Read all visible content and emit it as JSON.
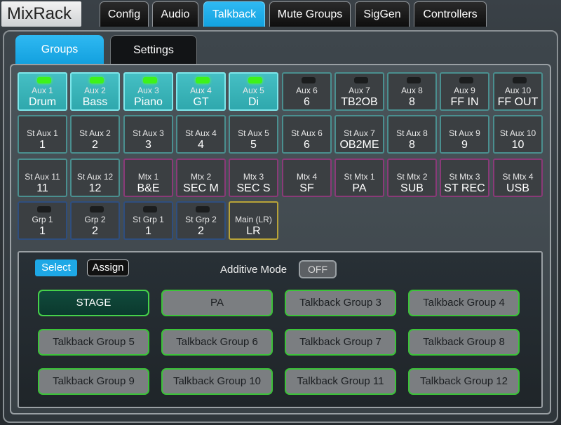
{
  "app": {
    "logo": "MixRack"
  },
  "top_tabs": [
    {
      "label": "Config"
    },
    {
      "label": "Audio"
    },
    {
      "label": "Talkback",
      "active": true
    },
    {
      "label": "Mute Groups"
    },
    {
      "label": "SigGen"
    },
    {
      "label": "Controllers"
    }
  ],
  "sub_tabs": [
    {
      "label": "Groups",
      "active": true
    },
    {
      "label": "Settings"
    }
  ],
  "buses": [
    {
      "label": "Aux 1",
      "value": "Drum",
      "led": "on",
      "selected": true,
      "kind": "aux"
    },
    {
      "label": "Aux 2",
      "value": "Bass",
      "led": "on",
      "selected": true,
      "kind": "aux"
    },
    {
      "label": "Aux 3",
      "value": "Piano",
      "led": "on",
      "selected": true,
      "kind": "aux"
    },
    {
      "label": "Aux 4",
      "value": "GT",
      "led": "on",
      "selected": true,
      "kind": "aux"
    },
    {
      "label": "Aux 5",
      "value": "Di",
      "led": "on",
      "selected": true,
      "kind": "aux"
    },
    {
      "label": "Aux 6",
      "value": "6",
      "led": "off",
      "kind": "aux"
    },
    {
      "label": "Aux 7",
      "value": "TB2OB",
      "led": "off",
      "kind": "aux"
    },
    {
      "label": "Aux 8",
      "value": "8",
      "led": "off",
      "kind": "aux"
    },
    {
      "label": "Aux 9",
      "value": "FF IN",
      "led": "off",
      "kind": "aux"
    },
    {
      "label": "Aux 10",
      "value": "FF OUT",
      "led": "off",
      "kind": "aux"
    },
    {
      "label": "St Aux 1",
      "value": "1",
      "led": "none",
      "kind": "aux"
    },
    {
      "label": "St Aux 2",
      "value": "2",
      "led": "none",
      "kind": "aux"
    },
    {
      "label": "St Aux 3",
      "value": "3",
      "led": "none",
      "kind": "aux"
    },
    {
      "label": "St Aux 4",
      "value": "4",
      "led": "none",
      "kind": "aux"
    },
    {
      "label": "St Aux 5",
      "value": "5",
      "led": "none",
      "kind": "aux"
    },
    {
      "label": "St Aux 6",
      "value": "6",
      "led": "none",
      "kind": "aux"
    },
    {
      "label": "St Aux 7",
      "value": "OB2ME",
      "led": "none",
      "kind": "aux"
    },
    {
      "label": "St Aux 8",
      "value": "8",
      "led": "none",
      "kind": "aux"
    },
    {
      "label": "St Aux 9",
      "value": "9",
      "led": "none",
      "kind": "aux"
    },
    {
      "label": "St Aux 10",
      "value": "10",
      "led": "none",
      "kind": "aux"
    },
    {
      "label": "St Aux 11",
      "value": "11",
      "led": "none",
      "kind": "aux"
    },
    {
      "label": "St Aux 12",
      "value": "12",
      "led": "none",
      "kind": "aux"
    },
    {
      "label": "Mtx 1",
      "value": "B&E",
      "led": "none",
      "kind": "mtx"
    },
    {
      "label": "Mtx 2",
      "value": "SEC M",
      "led": "none",
      "kind": "mtx"
    },
    {
      "label": "Mtx 3",
      "value": "SEC S",
      "led": "none",
      "kind": "mtx"
    },
    {
      "label": "Mtx 4",
      "value": "SF",
      "led": "none",
      "kind": "mtx"
    },
    {
      "label": "St Mtx 1",
      "value": "PA",
      "led": "none",
      "kind": "mtx"
    },
    {
      "label": "St Mtx 2",
      "value": "SUB",
      "led": "none",
      "kind": "mtx"
    },
    {
      "label": "St Mtx 3",
      "value": "ST REC",
      "led": "none",
      "kind": "mtx"
    },
    {
      "label": "St Mtx 4",
      "value": "USB",
      "led": "none",
      "kind": "mtx"
    },
    {
      "label": "Grp 1",
      "value": "1",
      "led": "off",
      "kind": "grp"
    },
    {
      "label": "Grp 2",
      "value": "2",
      "led": "off",
      "kind": "grp"
    },
    {
      "label": "St Grp 1",
      "value": "1",
      "led": "off",
      "kind": "grp"
    },
    {
      "label": "St Grp 2",
      "value": "2",
      "led": "off",
      "kind": "grp"
    },
    {
      "label": "Main (LR)",
      "value": "LR",
      "led": "none",
      "kind": "main"
    }
  ],
  "mode_buttons": {
    "select": "Select",
    "assign": "Assign",
    "active": "Select"
  },
  "additive_mode": {
    "label": "Additive Mode",
    "value": "OFF"
  },
  "talkback_groups": [
    {
      "label": "STAGE",
      "active": true
    },
    {
      "label": "PA"
    },
    {
      "label": "Talkback Group 3"
    },
    {
      "label": "Talkback Group 4"
    },
    {
      "label": "Talkback Group 5"
    },
    {
      "label": "Talkback Group 6"
    },
    {
      "label": "Talkback Group 7"
    },
    {
      "label": "Talkback Group 8"
    },
    {
      "label": "Talkback Group 9"
    },
    {
      "label": "Talkback Group 10"
    },
    {
      "label": "Talkback Group 11"
    },
    {
      "label": "Talkback Group 12"
    }
  ],
  "colors": {
    "accent_blue": "#1ea8e6",
    "selected_teal": "#3cb7bc",
    "led_on": "#3ef21a",
    "aux_border": "#4a8f8f",
    "mtx_border": "#8a3a78",
    "grp_border": "#2f4e7e",
    "main_border": "#b8a338",
    "tb_border": "#3bc338"
  }
}
